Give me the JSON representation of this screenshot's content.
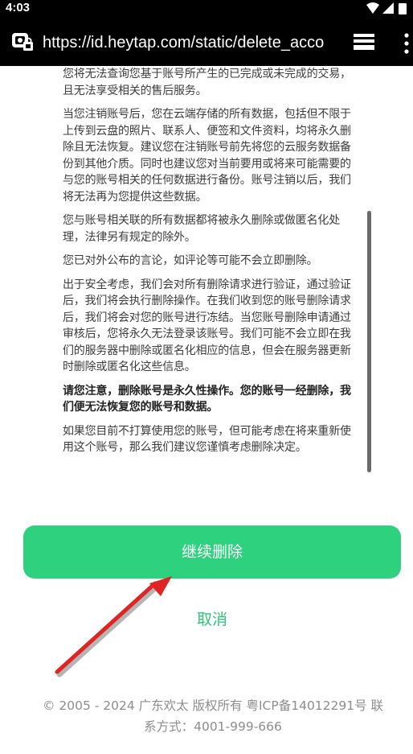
{
  "status_bar": {
    "time": "4:03",
    "icons": [
      "wifi-icon",
      "signal-icon",
      "battery-icon"
    ]
  },
  "browser": {
    "url": "https://id.heytap.com/static/delete_acco",
    "icons": [
      "site-security-icon",
      "tabs-icon",
      "overflow-menu-icon"
    ]
  },
  "content": {
    "paragraphs": [
      {
        "text": "您将无法查询您基于账号所产生的已完成或未完成的交易，且无法享受相关的售后服务。",
        "bold": false
      },
      {
        "text": "当您注销账号后，您在云端存储的所有数据，包括但不限于上传到云盘的照片、联系人、便签和文件资料，均将永久删除且无法恢复。建议您在注销账号前先将您的云服务数据备份到其他介质。同时也建议您对当前要用或将来可能需要的与您的账号相关的任何数据进行备份。账号注销以后，我们将无法再为您提供这些数据。",
        "bold": false
      },
      {
        "text": "您与账号相关联的所有数据都将被永久删除或做匿名化处理，法律另有规定的除外。",
        "bold": false
      },
      {
        "text": "您已对外公布的言论，如评论等可能不会立即删除。",
        "bold": false
      },
      {
        "text": "出于安全考虑，我们会对所有删除请求进行验证，通过验证后，我们将会执行删除操作。在我们收到您的账号删除请求后，我们将会对您的账号进行冻结。当您账号删除申请通过审核后，您将永久无法登录该账号。我们可能不会立即在我们的服务器中删除或匿名化相应的信息，但会在服务器更新时删除或匿名化这些信息。",
        "bold": false
      },
      {
        "text": "请您注意，删除账号是永久性操作。您的账号一经删除，我们便无法恢复您的账号和数据。",
        "bold": true
      },
      {
        "text": "如果您目前不打算使用您的账号，但可能考虑在将来重新使用这个账号，那么我们建议您谨慎考虑删除决定。",
        "bold": false
      }
    ]
  },
  "actions": {
    "continue_label": "继续删除",
    "cancel_label": "取消"
  },
  "footer": {
    "line1": "© 2005 - 2024 广东欢太 版权所有 粤ICP备14012291号 联",
    "line2": "系方式：4001-999-666"
  },
  "colors": {
    "primary_green": "#2ed17e",
    "link_green": "#2ec479",
    "annotation_arrow": "#e02424"
  }
}
